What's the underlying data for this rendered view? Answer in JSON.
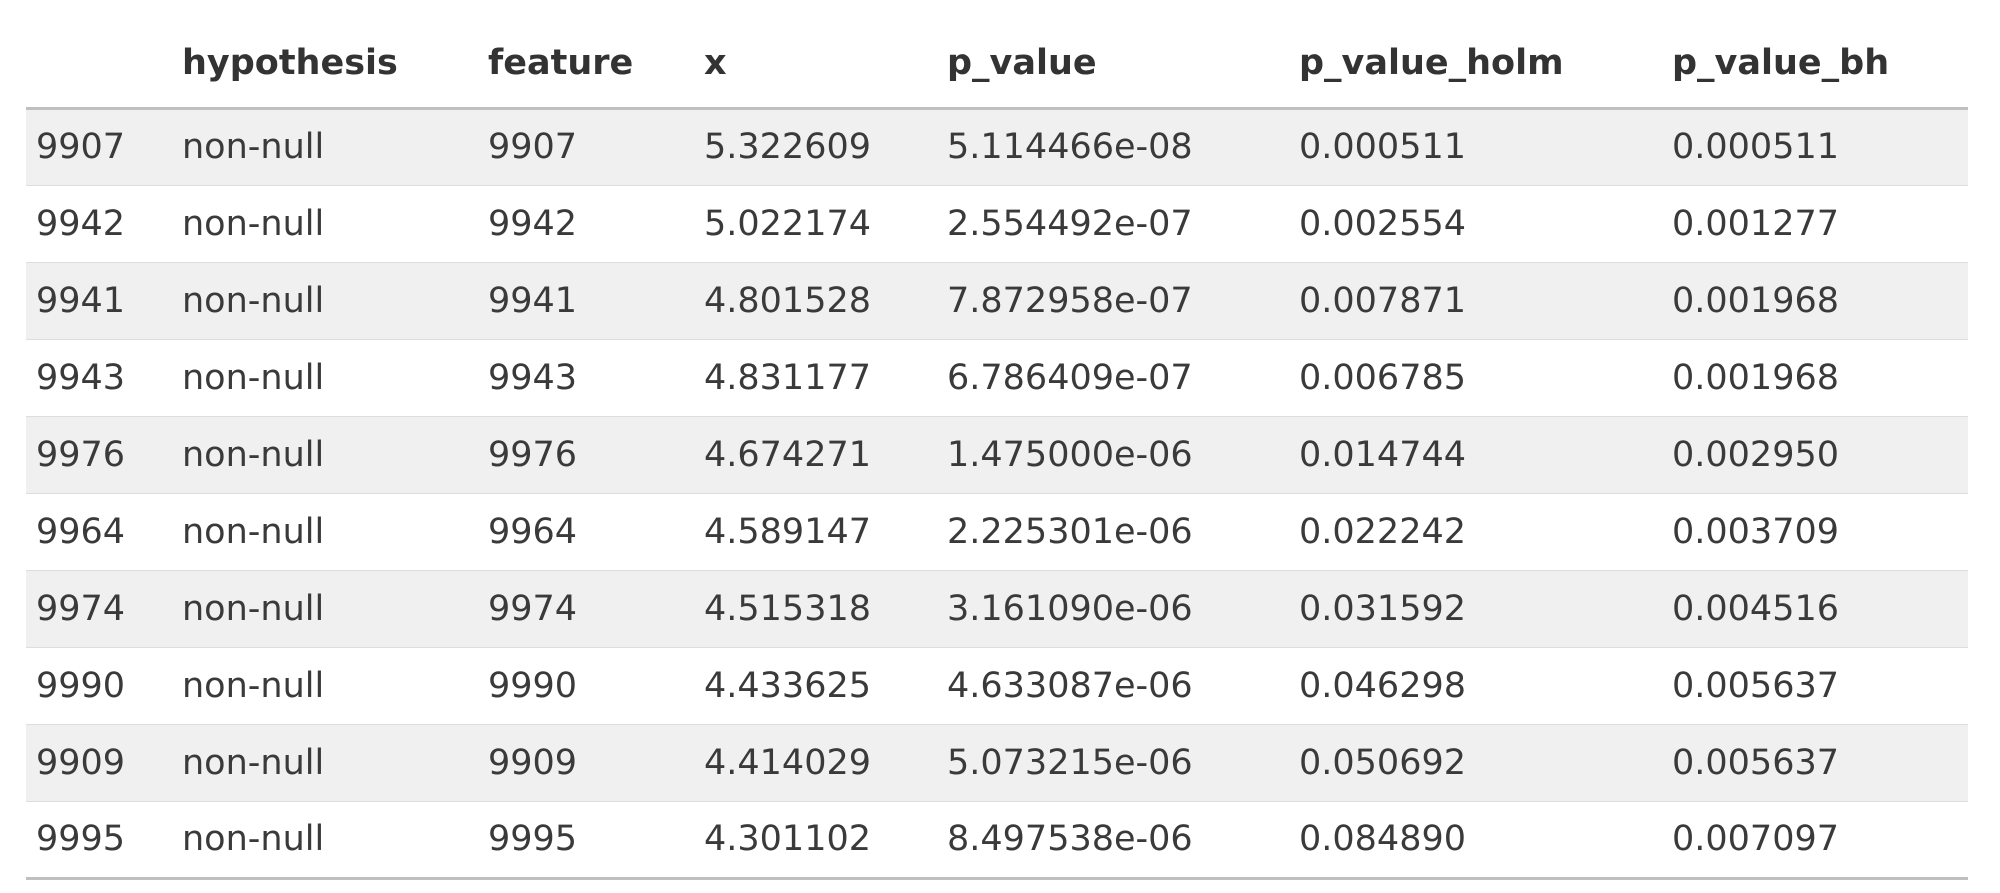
{
  "table": {
    "columns": [
      "",
      "hypothesis",
      "feature",
      "x",
      "p_value",
      "p_value_holm",
      "p_value_bh"
    ],
    "rows": [
      {
        "index": "9907",
        "hypothesis": "non-null",
        "feature": "9907",
        "x": "5.322609",
        "p_value": "5.114466e-08",
        "p_value_holm": "0.000511",
        "p_value_bh": "0.000511"
      },
      {
        "index": "9942",
        "hypothesis": "non-null",
        "feature": "9942",
        "x": "5.022174",
        "p_value": "2.554492e-07",
        "p_value_holm": "0.002554",
        "p_value_bh": "0.001277"
      },
      {
        "index": "9941",
        "hypothesis": "non-null",
        "feature": "9941",
        "x": "4.801528",
        "p_value": "7.872958e-07",
        "p_value_holm": "0.007871",
        "p_value_bh": "0.001968"
      },
      {
        "index": "9943",
        "hypothesis": "non-null",
        "feature": "9943",
        "x": "4.831177",
        "p_value": "6.786409e-07",
        "p_value_holm": "0.006785",
        "p_value_bh": "0.001968"
      },
      {
        "index": "9976",
        "hypothesis": "non-null",
        "feature": "9976",
        "x": "4.674271",
        "p_value": "1.475000e-06",
        "p_value_holm": "0.014744",
        "p_value_bh": "0.002950"
      },
      {
        "index": "9964",
        "hypothesis": "non-null",
        "feature": "9964",
        "x": "4.589147",
        "p_value": "2.225301e-06",
        "p_value_holm": "0.022242",
        "p_value_bh": "0.003709"
      },
      {
        "index": "9974",
        "hypothesis": "non-null",
        "feature": "9974",
        "x": "4.515318",
        "p_value": "3.161090e-06",
        "p_value_holm": "0.031592",
        "p_value_bh": "0.004516"
      },
      {
        "index": "9990",
        "hypothesis": "non-null",
        "feature": "9990",
        "x": "4.433625",
        "p_value": "4.633087e-06",
        "p_value_holm": "0.046298",
        "p_value_bh": "0.005637"
      },
      {
        "index": "9909",
        "hypothesis": "non-null",
        "feature": "9909",
        "x": "4.414029",
        "p_value": "5.073215e-06",
        "p_value_holm": "0.050692",
        "p_value_bh": "0.005637"
      },
      {
        "index": "9995",
        "hypothesis": "non-null",
        "feature": "9995",
        "x": "4.301102",
        "p_value": "8.497538e-06",
        "p_value_holm": "0.084890",
        "p_value_bh": "0.007097"
      }
    ]
  }
}
